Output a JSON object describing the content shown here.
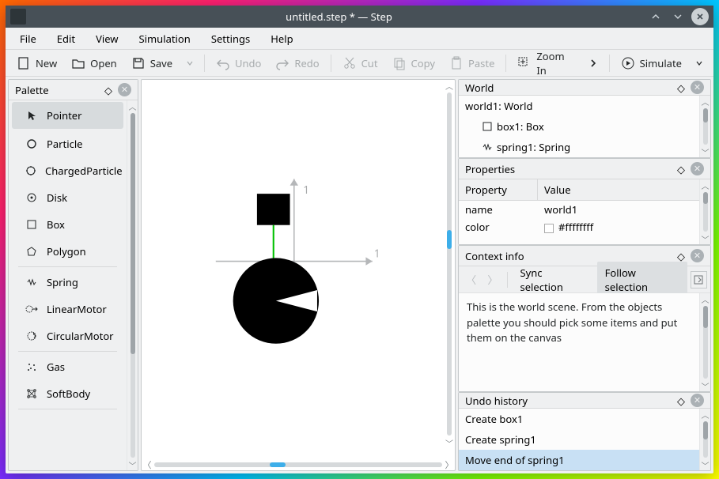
{
  "window": {
    "title": "untitled.step * — Step"
  },
  "menu": {
    "file": "File",
    "edit": "Edit",
    "view": "View",
    "simulation": "Simulation",
    "settings": "Settings",
    "help": "Help"
  },
  "toolbar": {
    "new": "New",
    "open": "Open",
    "save": "Save",
    "undo": "Undo",
    "redo": "Redo",
    "cut": "Cut",
    "copy": "Copy",
    "paste": "Paste",
    "zoom_in": "Zoom In",
    "simulate": "Simulate"
  },
  "palette": {
    "title": "Palette",
    "items": {
      "pointer": "Pointer",
      "particle": "Particle",
      "charged": "ChargedParticle",
      "disk": "Disk",
      "box": "Box",
      "polygon": "Polygon",
      "spring": "Spring",
      "linear_motor": "LinearMotor",
      "circular_motor": "CircularMotor",
      "gas": "Gas",
      "softbody": "SoftBody"
    }
  },
  "canvas": {
    "axis_x": "1",
    "axis_y": "1"
  },
  "world": {
    "title": "World",
    "root": "world1: World",
    "box": "box1: Box",
    "spring": "spring1: Spring"
  },
  "properties": {
    "title": "Properties",
    "col_property": "Property",
    "col_value": "Value",
    "rows": {
      "name": {
        "k": "name",
        "v": "world1"
      },
      "color": {
        "k": "color",
        "v": "#ffffffff"
      }
    }
  },
  "context": {
    "title": "Context info",
    "sync": "Sync selection",
    "follow": "Follow selection",
    "text": "This is the world scene. From the objects palette you should pick some items and put them on the canvas"
  },
  "undo": {
    "title": "Undo history",
    "items": {
      "a": "Create box1",
      "b": "Create spring1",
      "c": "Move end of spring1"
    }
  }
}
